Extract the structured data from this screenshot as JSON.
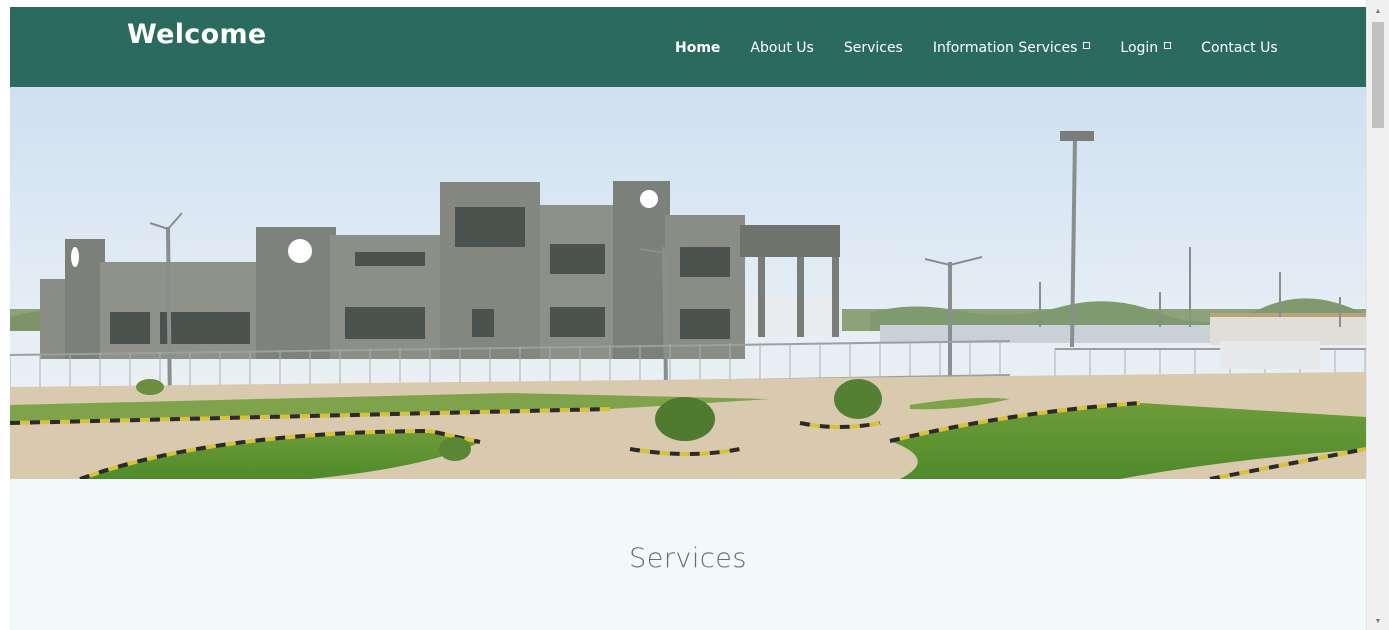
{
  "header": {
    "brand": "Welcome",
    "nav": [
      {
        "label": "Home",
        "active": true
      },
      {
        "label": "About Us"
      },
      {
        "label": "Services"
      },
      {
        "label": "Information Services",
        "dropdown": true
      },
      {
        "label": "Login",
        "dropdown": true
      },
      {
        "label": "Contact Us"
      }
    ]
  },
  "hero": {
    "image": "building-photo"
  },
  "services": {
    "title": "Services"
  },
  "colors": {
    "navbar_bg": "#2b6a5f",
    "services_bg": "#f3f8f8",
    "nav_text": "#ffffff"
  },
  "icons": {
    "dropdown": "caret-box-icon",
    "scroll_up": "scroll-up-arrow-icon",
    "scroll_down": "scroll-down-arrow-icon"
  }
}
